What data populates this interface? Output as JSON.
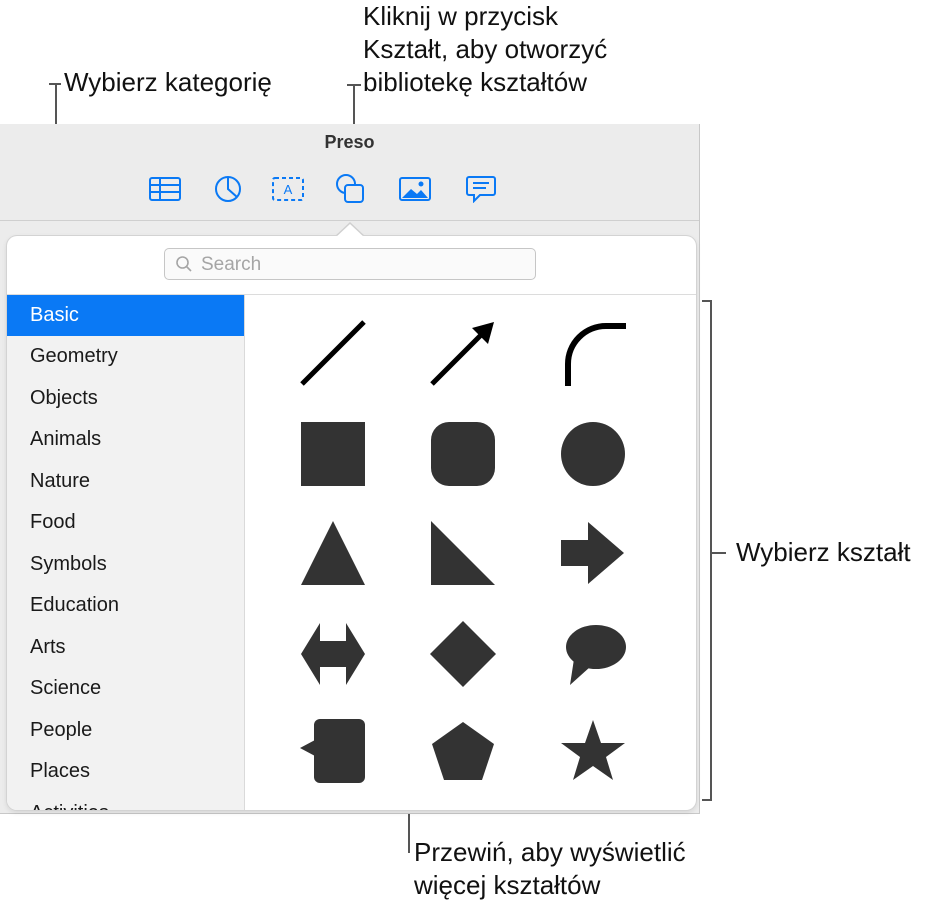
{
  "callouts": {
    "category": "Wybierz kategorię",
    "shape_button": "Kliknij w przycisk\nKształt, aby otworzyć\nbibliotekę kształtów",
    "pick_shape": "Wybierz kształt",
    "scroll": "Przewiń, aby wyświetlić\nwięcej kształtów"
  },
  "window": {
    "title": "Preso"
  },
  "toolbar": {
    "buttons": [
      {
        "icon": "table-icon"
      },
      {
        "icon": "chart-icon"
      },
      {
        "icon": "text-box-icon"
      },
      {
        "icon": "shape-icon"
      },
      {
        "icon": "media-icon"
      },
      {
        "icon": "comment-icon"
      }
    ],
    "accent": "#0a79f5"
  },
  "search": {
    "placeholder": "Search"
  },
  "categories": {
    "items": [
      "Basic",
      "Geometry",
      "Objects",
      "Animals",
      "Nature",
      "Food",
      "Symbols",
      "Education",
      "Arts",
      "Science",
      "People",
      "Places",
      "Activities"
    ],
    "selected": "Basic"
  },
  "shapes": [
    "line",
    "arrow-line",
    "curve",
    "square",
    "rounded-square",
    "circle",
    "triangle",
    "right-triangle",
    "arrow",
    "double-arrow",
    "diamond",
    "speech-bubble",
    "callout-square",
    "pentagon",
    "star"
  ],
  "colors": {
    "shape_fill": "#333333",
    "selection": "#0a79f5",
    "icon_blue": "#0a79f5"
  }
}
